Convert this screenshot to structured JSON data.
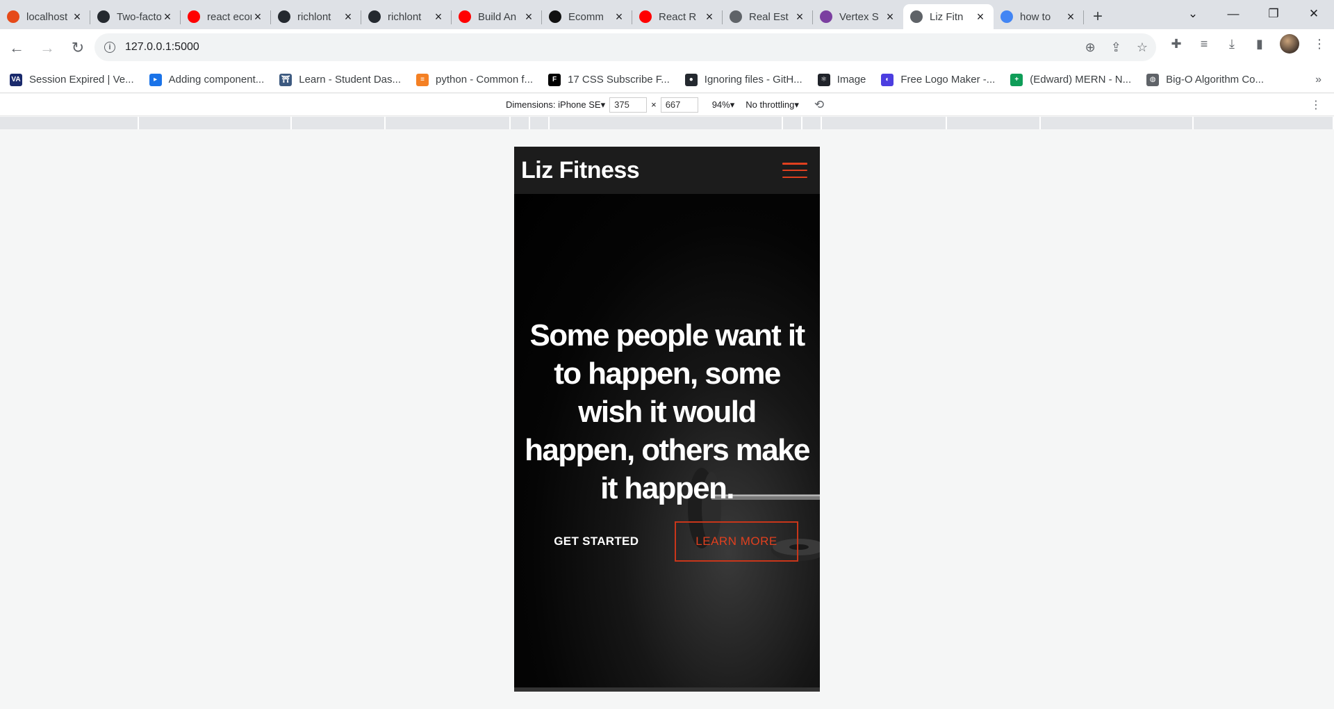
{
  "browser": {
    "tabs": [
      {
        "title": "localhost",
        "fav": "#e64a19",
        "icon": "react-app-icon"
      },
      {
        "title": "Two-factor",
        "fav": "#24292f",
        "icon": "github-icon"
      },
      {
        "title": "react ecom",
        "fav": "#ff0000",
        "icon": "youtube-icon"
      },
      {
        "title": "richlont",
        "fav": "#24292f",
        "icon": "github-icon"
      },
      {
        "title": "richlont",
        "fav": "#24292f",
        "icon": "github-icon"
      },
      {
        "title": "Build An",
        "fav": "#ff0000",
        "icon": "youtube-icon"
      },
      {
        "title": "Ecomm",
        "fav": "#111111",
        "icon": "site-icon"
      },
      {
        "title": "React R",
        "fav": "#ff0000",
        "icon": "youtube-icon"
      },
      {
        "title": "Real Est",
        "fav": "#5f6368",
        "icon": "globe-icon"
      },
      {
        "title": "Vertex S",
        "fav": "#7b3fa0",
        "icon": "vertex-icon"
      },
      {
        "title": "Liz Fitn",
        "fav": "#5f6368",
        "icon": "globe-icon",
        "active": true
      },
      {
        "title": "how to",
        "fav": "#4285f4",
        "icon": "google-icon"
      }
    ],
    "url": "127.0.0.1:5000",
    "bookmarks": [
      {
        "label": "Session Expired | Ve...",
        "fav": "#1a2a6c",
        "glyph": "VA"
      },
      {
        "label": "Adding component...",
        "fav": "#1a73e8",
        "glyph": "▸"
      },
      {
        "label": "Learn - Student Das...",
        "fav": "#3d5a80",
        "glyph": "⛩"
      },
      {
        "label": "python - Common f...",
        "fav": "#f48024",
        "glyph": "≡"
      },
      {
        "label": "17 CSS Subscribe F...",
        "fav": "#000000",
        "glyph": "F"
      },
      {
        "label": "Ignoring files - GitH...",
        "fav": "#24292f",
        "glyph": "●"
      },
      {
        "label": "Image",
        "fav": "#20232a",
        "glyph": "⚛"
      },
      {
        "label": "Free Logo Maker -...",
        "fav": "#4c3ee0",
        "glyph": "◐"
      },
      {
        "label": "(Edward) MERN - N...",
        "fav": "#0f9d58",
        "glyph": "+"
      },
      {
        "label": "Big-O Algorithm Co...",
        "fav": "#5f6368",
        "glyph": "◍"
      }
    ]
  },
  "devtools": {
    "dimensions_label": "Dimensions: iPhone SE",
    "width": "375",
    "height": "667",
    "times": "×",
    "zoom": "94%",
    "throttling": "No throttling"
  },
  "site": {
    "brand": "Liz Fitness",
    "headline": "Some people want it to happen, some wish it would happen, others make it happen.",
    "cta_primary": "GET STARTED",
    "cta_secondary": "LEARN MORE",
    "accent_color": "#e0401f"
  }
}
